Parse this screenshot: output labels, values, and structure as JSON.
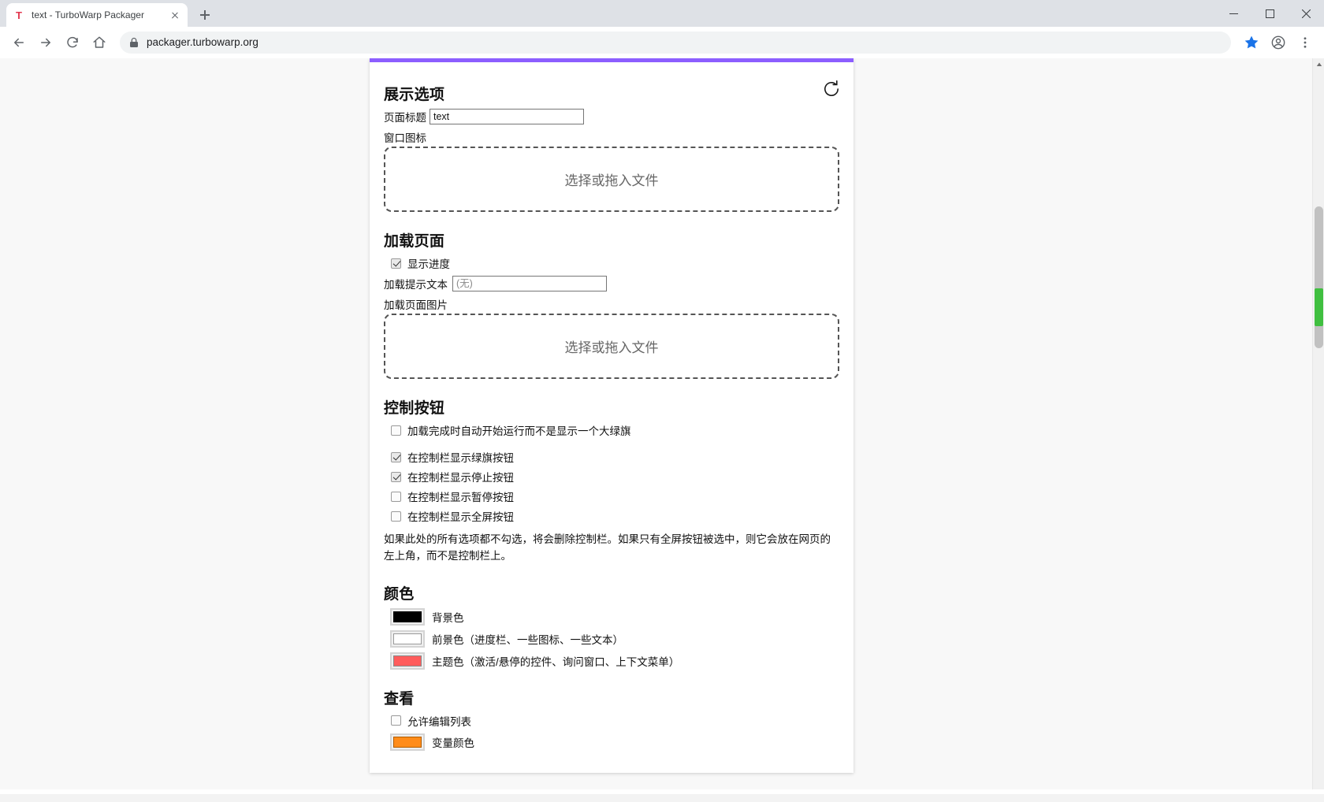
{
  "browser": {
    "tab": {
      "title": "text - TurboWarp Packager",
      "favicon": "T"
    },
    "new_tab_label": "+",
    "omnibox": {
      "url": "packager.turbowarp.org"
    },
    "window_controls": {
      "minimize": "minimize-button",
      "maximize": "maximize-button",
      "close": "close-button"
    },
    "nav": {
      "back": "back-button",
      "forward": "forward-button",
      "reload": "reload-button",
      "home": "home-button"
    },
    "right_icons": {
      "bookmark": "star-icon",
      "profile": "profile-icon",
      "menu": "more-menu-icon"
    }
  },
  "page": {
    "accent_color": "#8c5eff",
    "reset_label": "↺",
    "sections": {
      "display": {
        "heading": "展示选项",
        "page_title_label": "页面标题",
        "page_title_value": "text",
        "window_icon_label": "窗口图标",
        "window_icon_dropzone": "选择或拖入文件"
      },
      "loading": {
        "heading": "加载页面",
        "show_progress_label": "显示进度",
        "show_progress_checked": true,
        "loading_text_label": "加载提示文本",
        "loading_text_placeholder": "(无)",
        "loading_text_value": "",
        "loading_image_label": "加载页面图片",
        "loading_image_dropzone": "选择或拖入文件"
      },
      "controls": {
        "heading": "控制按钮",
        "items": [
          {
            "label": "加载完成时自动开始运行而不是显示一个大绿旗",
            "checked": false
          },
          {
            "label": "在控制栏显示绿旗按钮",
            "checked": true
          },
          {
            "label": "在控制栏显示停止按钮",
            "checked": true
          },
          {
            "label": "在控制栏显示暂停按钮",
            "checked": false
          },
          {
            "label": "在控制栏显示全屏按钮",
            "checked": false
          }
        ],
        "hint": "如果此处的所有选项都不勾选，将会删除控制栏。如果只有全屏按钮被选中，则它会放在网页的左上角，而不是控制栏上。"
      },
      "colors": {
        "heading": "颜色",
        "items": [
          {
            "label": "背景色",
            "value": "#000000"
          },
          {
            "label": "前景色（进度栏、一些图标、一些文本）",
            "value": "#ffffff"
          },
          {
            "label": "主题色（激活/悬停的控件、询问窗口、上下文菜单）",
            "value": "#ff5c5c"
          }
        ]
      },
      "view": {
        "heading": "查看",
        "allow_edit_list_label": "允许编辑列表",
        "allow_edit_list_checked": false,
        "variable_color_label": "变量颜色",
        "variable_color_value": "#ff8c1a"
      }
    }
  }
}
